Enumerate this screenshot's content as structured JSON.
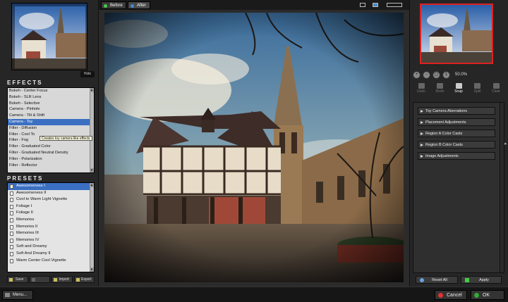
{
  "left": {
    "hide_label": "Hide",
    "effects_title": "EFFECTS",
    "effects": [
      "Bokeh - Center Focus",
      "Bokeh - SLR Lens",
      "Bokeh - Selective",
      "Camera - Pinhole",
      "Camera - Tilt & Shift",
      "Camera - Toy",
      "Filter - Diffusion",
      "Filter - Cool To",
      "Filter - Fog",
      "Filter - Graduated Color",
      "Filter - Graduated Neutral Density",
      "Filter - Polarization",
      "Filter - Reflector"
    ],
    "effects_selected_index": 5,
    "tooltip": "Creates toy camera like effects",
    "presets_title": "PRESETS",
    "presets": [
      "Awesomeness I",
      "Awesomeness II",
      "Cool to Warm Light Vignette",
      "Foliage I",
      "Foliage II",
      "Memories",
      "Memories II",
      "Memories III",
      "Memories IV",
      "Soft and Dreamy",
      "Soft And Dreamy II",
      "Warm Center Cool Vignette"
    ],
    "presets_selected_index": 0,
    "buttons": {
      "save": "Save",
      "delete": "",
      "import": "Import",
      "export": "Export"
    }
  },
  "center": {
    "tabs": {
      "before": "Before",
      "after": "After"
    }
  },
  "right": {
    "zoom_level": "50.0%",
    "tools": [
      "Undo",
      "Redo",
      "Snap",
      "Split",
      "Clear"
    ],
    "active_tool": "Snap",
    "adjustments": [
      "Toy Camera Aberrations",
      "Placement Adjustments",
      "Region A Color Casts",
      "Region B Color Casts",
      "Image Adjustments"
    ],
    "reset_label": "Reset All",
    "apply_label": "Apply"
  },
  "bottom": {
    "menu_label": "Menu...",
    "cancel_label": "Cancel",
    "ok_label": "OK"
  },
  "colors": {
    "selection": "#3b6fc2",
    "thumb_border": "#dd2222",
    "panel": "#262626"
  }
}
